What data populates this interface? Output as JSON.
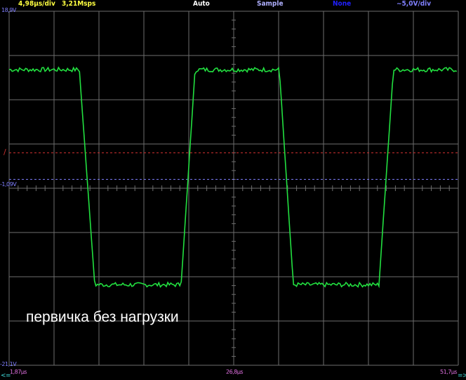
{
  "status_bar": {
    "timebase": "4,98µs/div",
    "sample_rate": "3,21Msps",
    "trigger_mode": "Auto",
    "acquisition": "Sample",
    "math": "None",
    "volts_div": "~5,0V/div"
  },
  "axis": {
    "v_top": "18,9V",
    "v_mid": "-1,09V",
    "v_bottom": "-21,1V",
    "t_left": "1,87µs",
    "t_mid": "26,8µs",
    "t_right": "51,7µs",
    "scroll_left": "<=",
    "scroll_right": "=>",
    "trigger_marker": "/"
  },
  "caption": "первичка без нагрузки",
  "colors": {
    "trace": "#22e040",
    "grid": "#6e6e6e",
    "trigger": "#d03030",
    "offset": "#8080ff",
    "header_yellow": "#ffff40"
  },
  "chart_data": {
    "type": "line",
    "xlim": [
      1.87,
      51.7
    ],
    "ylim": [
      -21.1,
      18.9
    ],
    "x_unit": "µs",
    "y_unit": "V",
    "trigger_level": 2.9,
    "ground_level": -0.1,
    "high_level": 12.3,
    "low_level": -12.0,
    "edges": [
      {
        "dir": "fall",
        "start": 9.66,
        "end": 11.37
      },
      {
        "dir": "rise",
        "start": 20.95,
        "end": 22.5
      },
      {
        "dir": "fall",
        "start": 31.85,
        "end": 33.4
      },
      {
        "dir": "rise",
        "start": 42.9,
        "end": 44.5
      }
    ]
  }
}
